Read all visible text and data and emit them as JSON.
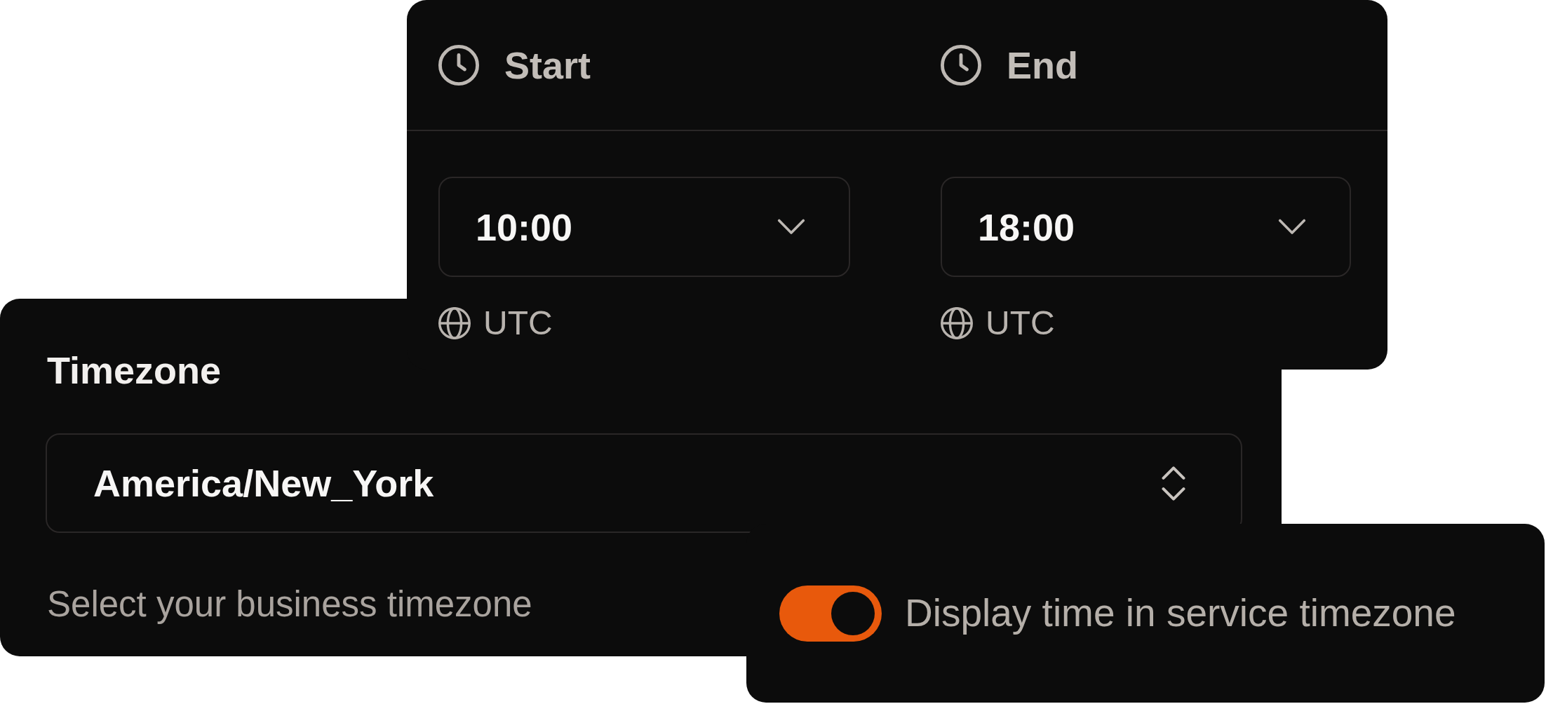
{
  "schedule_card": {
    "columns": [
      {
        "label": "Start",
        "time": "10:00",
        "timezone": "UTC"
      },
      {
        "label": "End",
        "time": "18:00",
        "timezone": "UTC"
      }
    ]
  },
  "timezone_card": {
    "label": "Timezone",
    "value": "America/New_York",
    "help_text": "Select your business timezone"
  },
  "display_toggle": {
    "label": "Display time in service timezone",
    "on": true
  }
}
